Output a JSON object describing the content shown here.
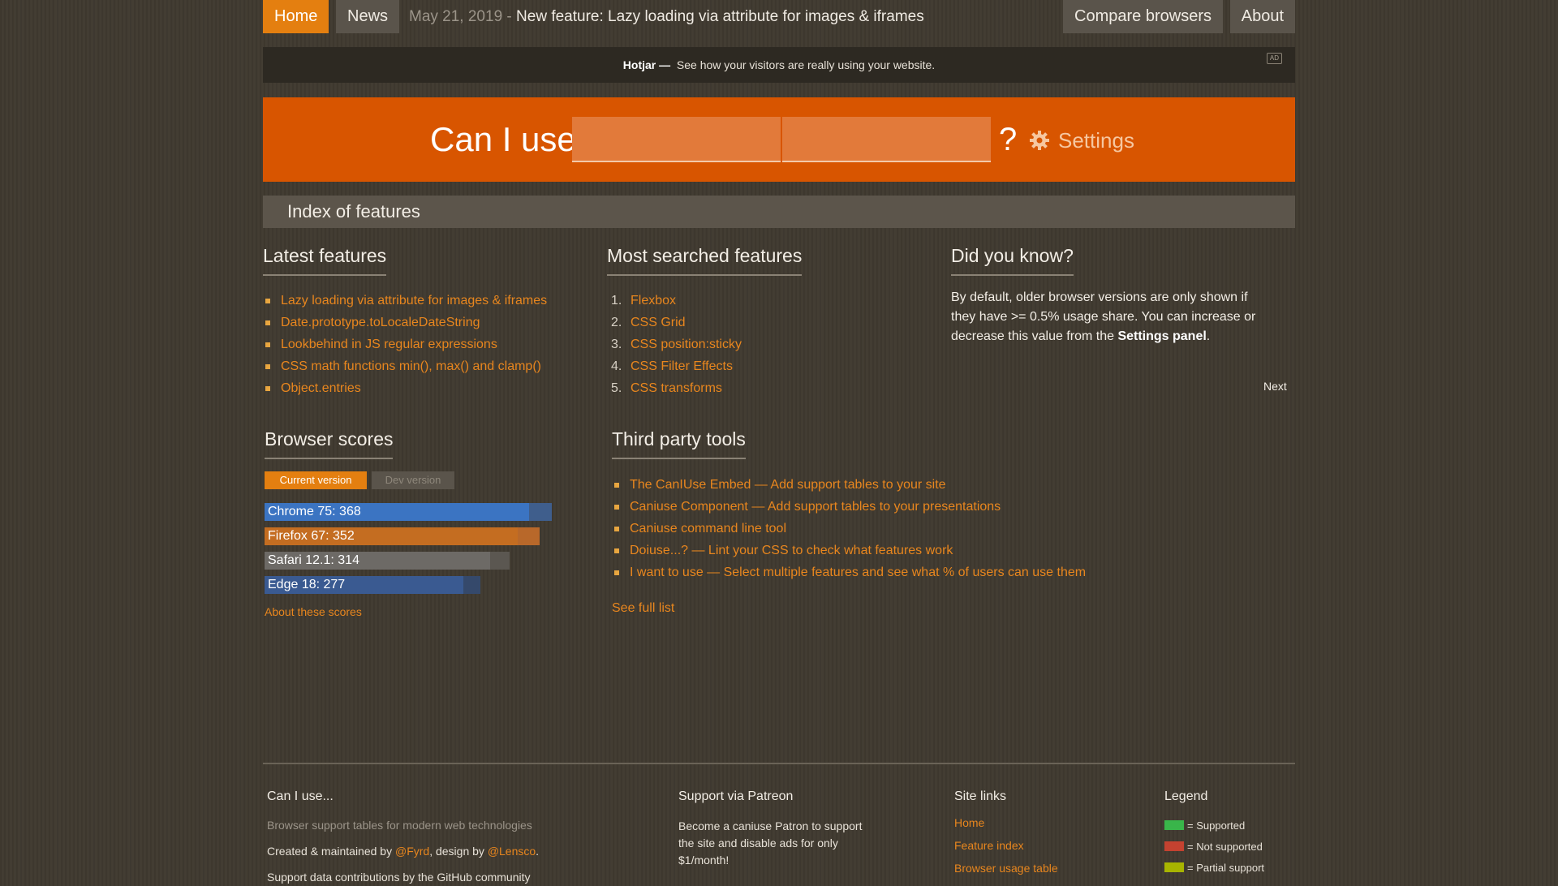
{
  "nav": {
    "home": "Home",
    "news": "News",
    "news_date": "May 21, 2019 -",
    "news_title": "New feature: Lazy loading via attribute for images & iframes",
    "compare": "Compare browsers",
    "about": "About"
  },
  "ad": {
    "brand": "Hotjar —",
    "text": "See how your visitors are really using your website.",
    "badge": "AD"
  },
  "search": {
    "label": "Can I use",
    "question": "?",
    "settings": "Settings"
  },
  "index_title": "Index of features",
  "latest": {
    "title": "Latest features",
    "items": [
      "Lazy loading via attribute for images & iframes",
      "Date.prototype.toLocaleDateString",
      "Lookbehind in JS regular expressions",
      "CSS math functions min(), max() and clamp()",
      "Object.entries"
    ]
  },
  "most_searched": {
    "title": "Most searched features",
    "items": [
      {
        "num": "1.",
        "label": "Flexbox"
      },
      {
        "num": "2.",
        "label": "CSS Grid"
      },
      {
        "num": "3.",
        "label": "CSS position:sticky"
      },
      {
        "num": "4.",
        "label": "CSS Filter Effects"
      },
      {
        "num": "5.",
        "label": "CSS transforms"
      }
    ]
  },
  "did_you_know": {
    "title": "Did you know?",
    "text_before": "By default, older browser versions are only shown if they have >= 0.5% usage share. You can increase or decrease this value from the ",
    "bold": "Settings panel",
    "text_after": ".",
    "next": "Next"
  },
  "browser_scores": {
    "title": "Browser scores",
    "tab_current": "Current version",
    "tab_dev": "Dev version",
    "bars": [
      {
        "label": "Chrome 75: 368",
        "score": 368,
        "track_color": "#3f5e8c",
        "fill_color": "#3b74c2"
      },
      {
        "label": "Firefox 67: 352",
        "score": 352,
        "track_color": "#b8682a",
        "fill_color": "#c46d21"
      },
      {
        "label": "Safari 12.1: 314",
        "score": 314,
        "track_color": "#5b5751",
        "fill_color": "#6d6a66"
      },
      {
        "label": "Edge 18: 277",
        "score": 277,
        "track_color": "#35496b",
        "fill_color": "#3a5a91"
      }
    ],
    "max_score": 395,
    "about": "About these scores"
  },
  "third_party": {
    "title": "Third party tools",
    "items": [
      "The CanIUse Embed — Add support tables to your site",
      "Caniuse Component — Add support tables to your presentations",
      "Caniuse command line tool",
      "Doiuse...? — Lint your CSS to check what features work",
      "I want to use — Select multiple features and see what % of users can use them"
    ],
    "see_full": "See full list"
  },
  "footer": {
    "col1_title": "Can I use...",
    "col1_desc": "Browser support tables for modern web technologies",
    "col1_created": "Created & maintained by ",
    "col1_fyrd": "@Fyrd",
    "col1_design": ", design by ",
    "col1_lensco": "@Lensco",
    "col1_end": ".",
    "col1_cut": "Support data contributions by the GitHub community",
    "col2_title": "Support via Patreon",
    "col2_text": "Become a caniuse Patron to support the site and disable ads for only $1/month!",
    "col3_title": "Site links",
    "col3_links": [
      "Home",
      "Feature index",
      "Browser usage table"
    ],
    "col4_title": "Legend",
    "legend": [
      {
        "color": "#39b54a",
        "label": "= Supported"
      },
      {
        "color": "#c44230",
        "label": "= Not supported"
      },
      {
        "color": "#a8b400",
        "label": "= Partial support"
      }
    ]
  }
}
